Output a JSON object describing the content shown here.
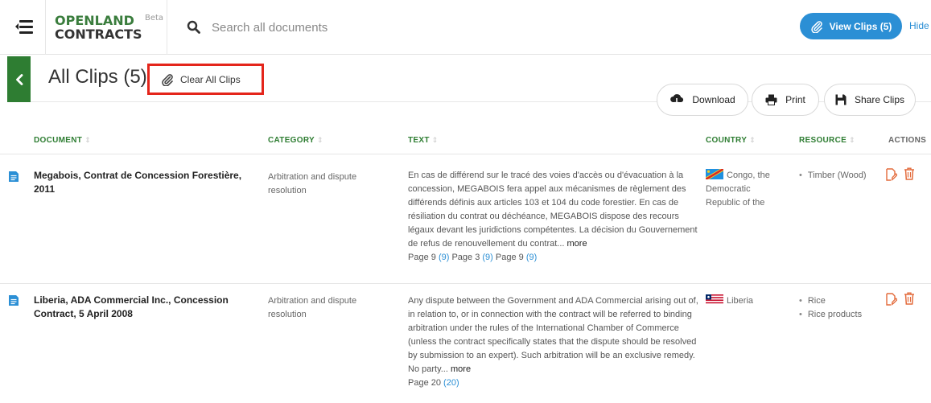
{
  "header": {
    "logo_line1": "OPENLAND",
    "logo_line2": "CONTRACTS",
    "logo_badge": "Beta",
    "search_placeholder": "Search all documents",
    "view_clips_label": "View Clips (5)",
    "hide_label": "Hide"
  },
  "subheader": {
    "title": "All Clips (5)",
    "clear_label": "Clear All Clips",
    "download_label": "Download",
    "print_label": "Print",
    "share_label": "Share Clips"
  },
  "table": {
    "columns": {
      "document": "DOCUMENT",
      "category": "CATEGORY",
      "text": "TEXT",
      "country": "COUNTRY",
      "resource": "RESOURCE",
      "actions": "ACTIONS"
    },
    "sort_glyph": "⇕",
    "rows": [
      {
        "document_line1": "Megabois, Contrat de Concession Forestière,",
        "document_line2": "2011",
        "category_line1": "Arbitration and dispute",
        "category_line2": "resolution",
        "text_lines": [
          "En cas de différend sur le tracé des voies d'accès ou d'évacuation à la",
          "concession, MEGABOIS fera appel aux mécanismes de règlement des",
          "différends définis aux articles 103 et 104 du code forestier. En cas de",
          "résiliation du contrat ou déchéance, MEGABOIS dispose des recours",
          "légaux devant les juridictions compétentes. La décision du Gouvernement",
          "de refus de renouvellement du contrat..."
        ],
        "more_label": "more",
        "pages": [
          {
            "label": "Page 9",
            "num": "(9)"
          },
          {
            "label": "Page 3",
            "num": "(9)"
          },
          {
            "label": "Page 9",
            "num": "(9)"
          }
        ],
        "country_line1": "Congo, the",
        "country_line2": "Democratic",
        "country_line3": "Republic of the",
        "resources": [
          "Timber (Wood)"
        ]
      },
      {
        "document_line1": "Liberia, ADA Commercial Inc., Concession",
        "document_line2": "Contract, 5 April 2008",
        "category_line1": "Arbitration and dispute",
        "category_line2": "resolution",
        "text_lines": [
          "Any dispute between the Government and ADA Commercial arising out of,",
          "in relation to, or in connection with the contract will be referred to binding",
          "arbitration under the rules of the International Chamber of Commerce",
          "(unless the contract specifically states that the dispute should be resolved",
          "by submission to an expert). Such arbitration will be an exclusive remedy.",
          "No party..."
        ],
        "more_label": "more",
        "pages": [
          {
            "label": "Page 20",
            "num": "(20)"
          }
        ],
        "country_line1": "Liberia",
        "resources": [
          "Rice",
          "Rice products"
        ]
      }
    ]
  },
  "colors": {
    "brand_green": "#2e7d32",
    "accent_blue": "#2b8fd5",
    "highlight_red": "#e4251b",
    "action_orange": "#e36b3c"
  }
}
